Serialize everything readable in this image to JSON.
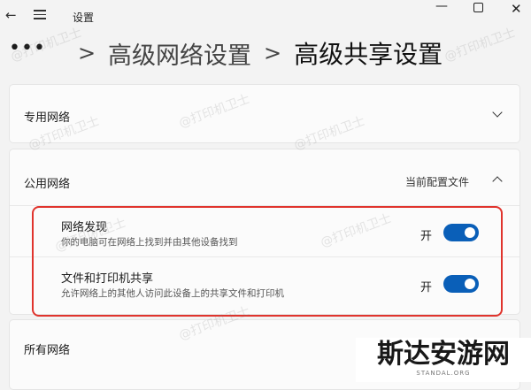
{
  "window": {
    "title": "设置"
  },
  "breadcrumb": {
    "overflow": "•••",
    "separator": ">",
    "parent": "高级网络设置",
    "current": "高级共享设置"
  },
  "sections": {
    "private": {
      "title": "专用网络"
    },
    "public": {
      "title": "公用网络",
      "profile_label": "当前配置文件",
      "settings": [
        {
          "title": "网络发现",
          "description": "你的电脑可在网络上找到并由其他设备找到",
          "state_label": "开",
          "on": true
        },
        {
          "title": "文件和打印机共享",
          "description": "允许网络上的其他人访问此设备上的共享文件和打印机",
          "state_label": "开",
          "on": true
        }
      ]
    },
    "all": {
      "title": "所有网络"
    }
  },
  "watermark": "@打印机卫士",
  "logo": {
    "main": "斯达安游网",
    "sub": "STANDAL.ORG"
  },
  "colors": {
    "accent": "#0a5fb8",
    "highlight": "#e0342d"
  },
  "icons": [
    "back-arrow-icon",
    "hamburger-menu-icon",
    "minimize-icon",
    "maximize-icon",
    "close-icon",
    "chevron-down-icon",
    "chevron-up-icon"
  ]
}
